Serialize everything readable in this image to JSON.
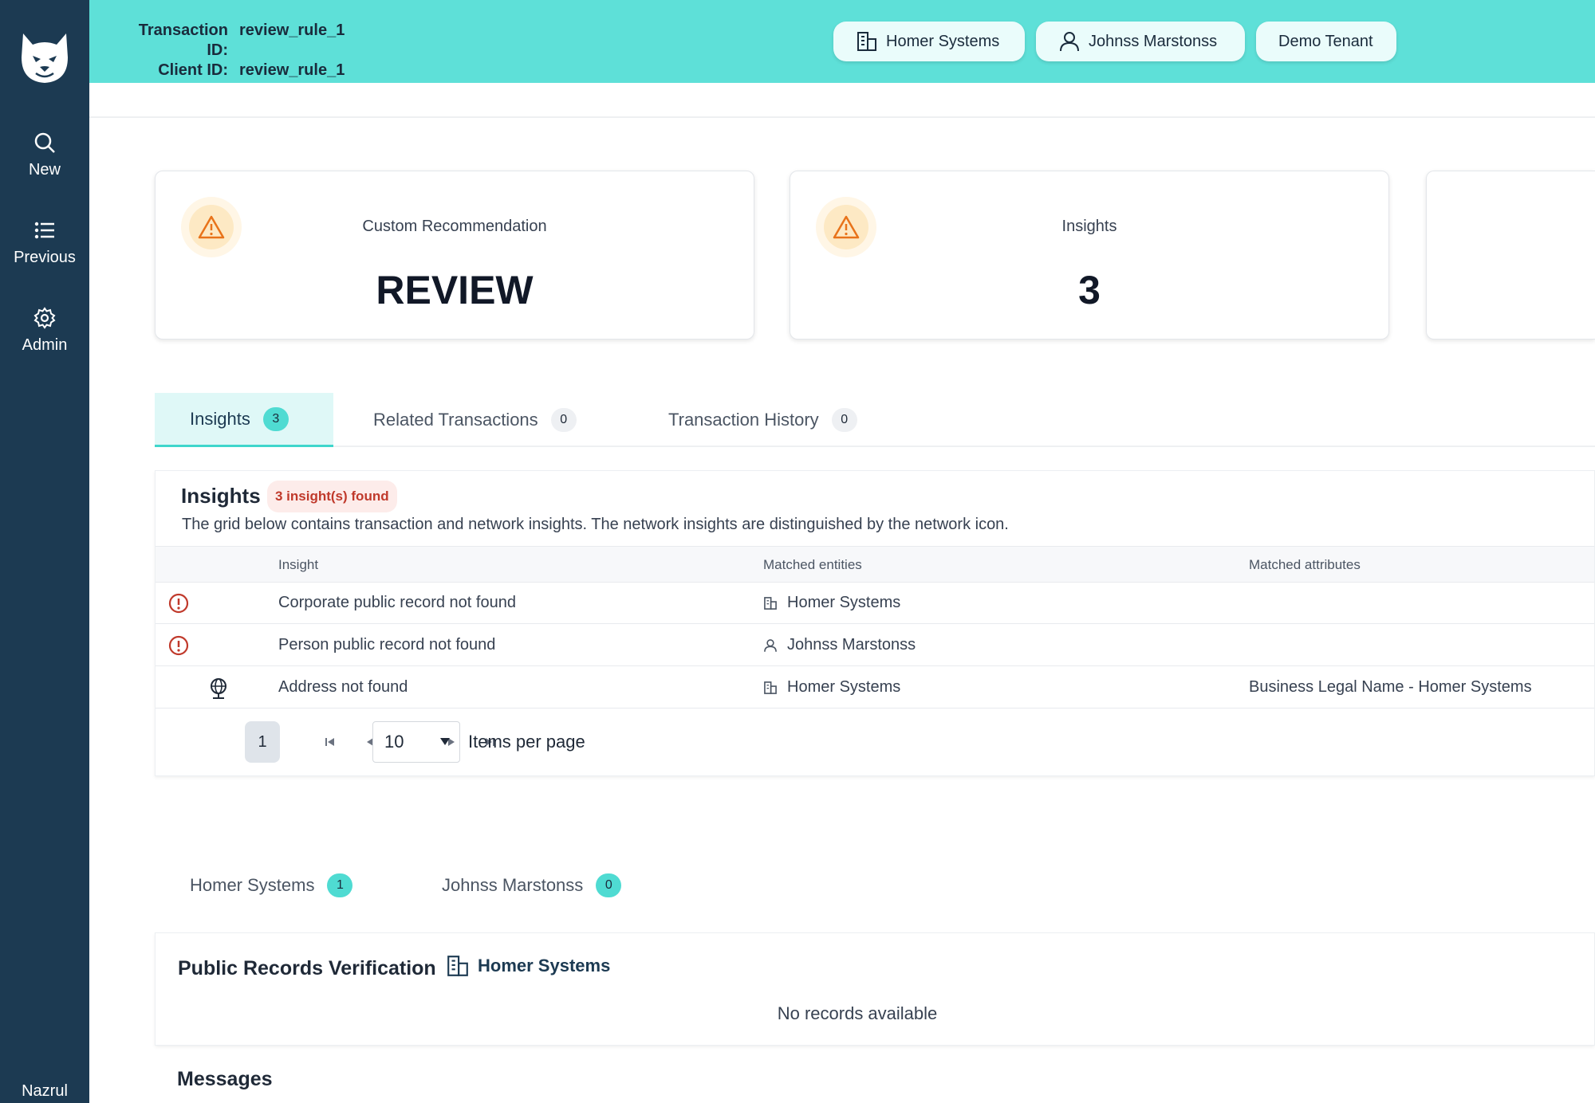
{
  "sidebar": {
    "logo": "wildcat-logo",
    "items": [
      {
        "label": "New",
        "icon": "search-icon"
      },
      {
        "label": "Previous",
        "icon": "list-icon"
      },
      {
        "label": "Admin",
        "icon": "gear-icon"
      }
    ],
    "user": "Nazrul"
  },
  "header": {
    "transaction_label": "Transaction ID:",
    "transaction_id": "review_rule_1",
    "client_label": "Client ID:",
    "client_id": "review_rule_1",
    "pills": [
      {
        "label": "Homer Systems",
        "icon": "building-icon"
      },
      {
        "label": "Johnss Marstonss",
        "icon": "person-icon"
      },
      {
        "label": "Demo Tenant"
      }
    ],
    "accent_color": "#5ee0d8"
  },
  "cards": [
    {
      "label": "Custom Recommendation",
      "value": "REVIEW",
      "icon": "warning-icon"
    },
    {
      "label": "Insights",
      "value": "3",
      "icon": "warning-icon"
    }
  ],
  "tabs": [
    {
      "label": "Insights",
      "count": "3",
      "active": true
    },
    {
      "label": "Related Transactions",
      "count": "0"
    },
    {
      "label": "Transaction History",
      "count": "0"
    }
  ],
  "insights": {
    "title": "Insights",
    "badge": "3 insight(s) found",
    "description": "The grid below contains transaction and network insights. The network insights are distinguished by the network icon.",
    "columns": [
      "Insight",
      "Matched entities",
      "Matched attributes"
    ],
    "rows": [
      {
        "icon": "alert-circle-icon",
        "insight": "Corporate public record not found",
        "entity_icon": "building-icon",
        "entity": "Homer Systems",
        "attributes": ""
      },
      {
        "icon": "alert-circle-icon",
        "insight": "Person public record not found",
        "entity_icon": "person-icon",
        "entity": "Johnss Marstonss",
        "attributes": ""
      },
      {
        "icon": "network-globe-icon",
        "insight": "Address not found",
        "entity_icon": "building-icon",
        "entity": "Homer Systems",
        "attributes": "Business Legal Name - Homer Systems"
      }
    ],
    "pager": {
      "page": "1",
      "items_per_page": "10",
      "items_per_page_label": "Items per page"
    }
  },
  "entity_tabs": [
    {
      "label": "Homer Systems",
      "count": "1"
    },
    {
      "label": "Johnss Marstonss",
      "count": "0"
    }
  ],
  "public_records": {
    "title": "Public Records Verification",
    "entity": "Homer Systems",
    "empty": "No records available"
  },
  "messages": {
    "title": "Messages"
  }
}
